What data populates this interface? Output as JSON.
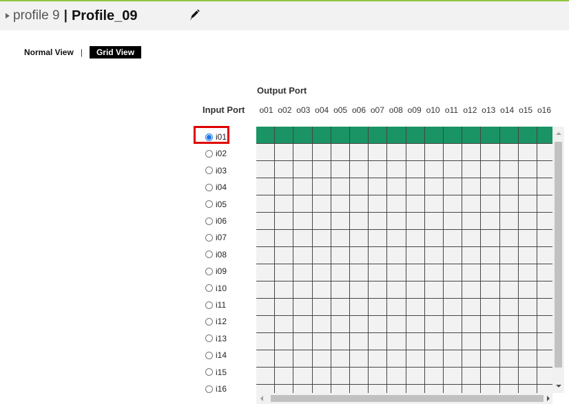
{
  "header": {
    "profile_label": "profile 9",
    "separator": "|",
    "profile_name": "Profile_09",
    "edit_icon": "pencil-icon"
  },
  "view_tabs": {
    "normal_label": "Normal View",
    "separator": "|",
    "grid_label": "Grid View",
    "active": "Grid View"
  },
  "matrix": {
    "output_title": "Output Port",
    "input_title": "Input Port",
    "outputs": [
      "o01",
      "o02",
      "o03",
      "o04",
      "o05",
      "o06",
      "o07",
      "o08",
      "o09",
      "o10",
      "o11",
      "o12",
      "o13",
      "o14",
      "o15",
      "o16"
    ],
    "inputs": [
      "i01",
      "i02",
      "i03",
      "i04",
      "i05",
      "i06",
      "i07",
      "i08",
      "i09",
      "i10",
      "i11",
      "i12",
      "i13",
      "i14",
      "i15",
      "i16"
    ],
    "selected_input": "i01",
    "routes": {
      "i01": [
        "o01",
        "o02",
        "o03",
        "o04",
        "o05",
        "o06",
        "o07",
        "o08",
        "o09",
        "o10",
        "o11",
        "o12",
        "o13",
        "o14",
        "o15",
        "o16"
      ]
    }
  },
  "colors": {
    "active_cell": "#1a9464",
    "inactive_cell": "#f2f2f2",
    "accent_line": "#8dc63f",
    "highlight": "#e00000"
  }
}
